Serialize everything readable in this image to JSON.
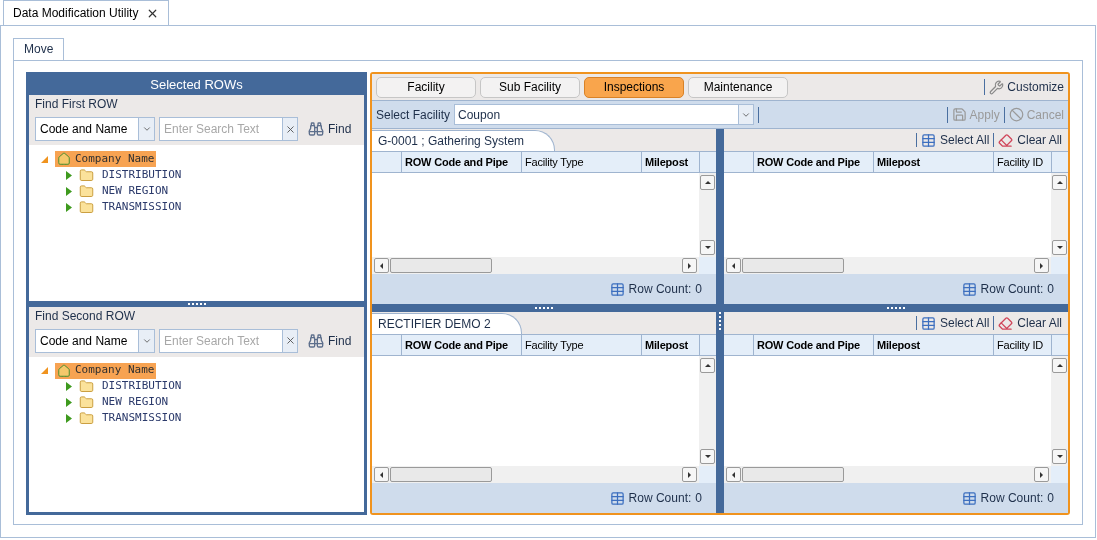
{
  "document_tab": {
    "title": "Data Modification Utility"
  },
  "tabs": [
    {
      "label": "Move",
      "selected": true
    }
  ],
  "left_panel": {
    "title": "Selected ROWs",
    "sections": [
      {
        "title": "Find First ROW",
        "search_by": "Code and Name",
        "search": {
          "placeholder": "Enter Search Text"
        },
        "find_button": "Find",
        "tree": [
          {
            "label": "Company Name",
            "selected": true,
            "expanded": true,
            "children": [
              {
                "label": "DISTRIBUTION",
                "selected": false,
                "expanded": false
              },
              {
                "label": "NEW REGION",
                "selected": false,
                "expanded": false
              },
              {
                "label": "TRANSMISSION",
                "selected": false,
                "expanded": false
              }
            ]
          }
        ]
      },
      {
        "title": "Find Second ROW",
        "search_by": "Code and Name",
        "search": {
          "placeholder": "Enter Search Text"
        },
        "find_button": "Find",
        "tree": [
          {
            "label": "Company Name",
            "selected": true,
            "expanded": true,
            "children": [
              {
                "label": "DISTRIBUTION",
                "selected": false,
                "expanded": false
              },
              {
                "label": "NEW REGION",
                "selected": false,
                "expanded": false
              },
              {
                "label": "TRANSMISSION",
                "selected": false,
                "expanded": false
              }
            ]
          }
        ]
      }
    ]
  },
  "right_panel": {
    "tabs": [
      {
        "label": "Facility",
        "selected": false
      },
      {
        "label": "Sub Facility",
        "selected": false
      },
      {
        "label": "Inspections",
        "selected": true
      },
      {
        "label": "Maintenance",
        "selected": false
      }
    ],
    "customize": "Customize",
    "select_facility": {
      "label": "Select Facility",
      "value": "Coupon"
    },
    "apply": {
      "label": "Apply",
      "disabled": true
    },
    "cancel": {
      "label": "Cancel",
      "disabled": true
    },
    "grids": [
      {
        "kind": "source",
        "caption": "G-0001 ; Gathering System",
        "columns": [
          {
            "label": "ROW Code and Pipe",
            "bold": true
          },
          {
            "label": "Facility Type",
            "bold": false
          },
          {
            "label": "Milepost",
            "bold": true
          }
        ],
        "row_count_label": "Row Count:",
        "row_count": "0"
      },
      {
        "kind": "target",
        "select_all": "Select All",
        "clear_all": "Clear All",
        "columns": [
          {
            "label": "ROW Code and Pipe",
            "bold": true
          },
          {
            "label": "Milepost",
            "bold": true
          },
          {
            "label": "Facility ID",
            "bold": false
          }
        ],
        "row_count_label": "Row Count:",
        "row_count": "0"
      },
      {
        "kind": "source",
        "caption": "RECTIFIER DEMO 2",
        "columns": [
          {
            "label": "ROW Code and Pipe",
            "bold": true
          },
          {
            "label": "Facility Type",
            "bold": false
          },
          {
            "label": "Milepost",
            "bold": true
          }
        ],
        "row_count_label": "Row Count:",
        "row_count": "0"
      },
      {
        "kind": "target",
        "select_all": "Select All",
        "clear_all": "Clear All",
        "columns": [
          {
            "label": "ROW Code and Pipe",
            "bold": true
          },
          {
            "label": "Milepost",
            "bold": true
          },
          {
            "label": "Facility ID",
            "bold": false
          }
        ],
        "row_count_label": "Row Count:",
        "row_count": "0"
      }
    ]
  }
}
